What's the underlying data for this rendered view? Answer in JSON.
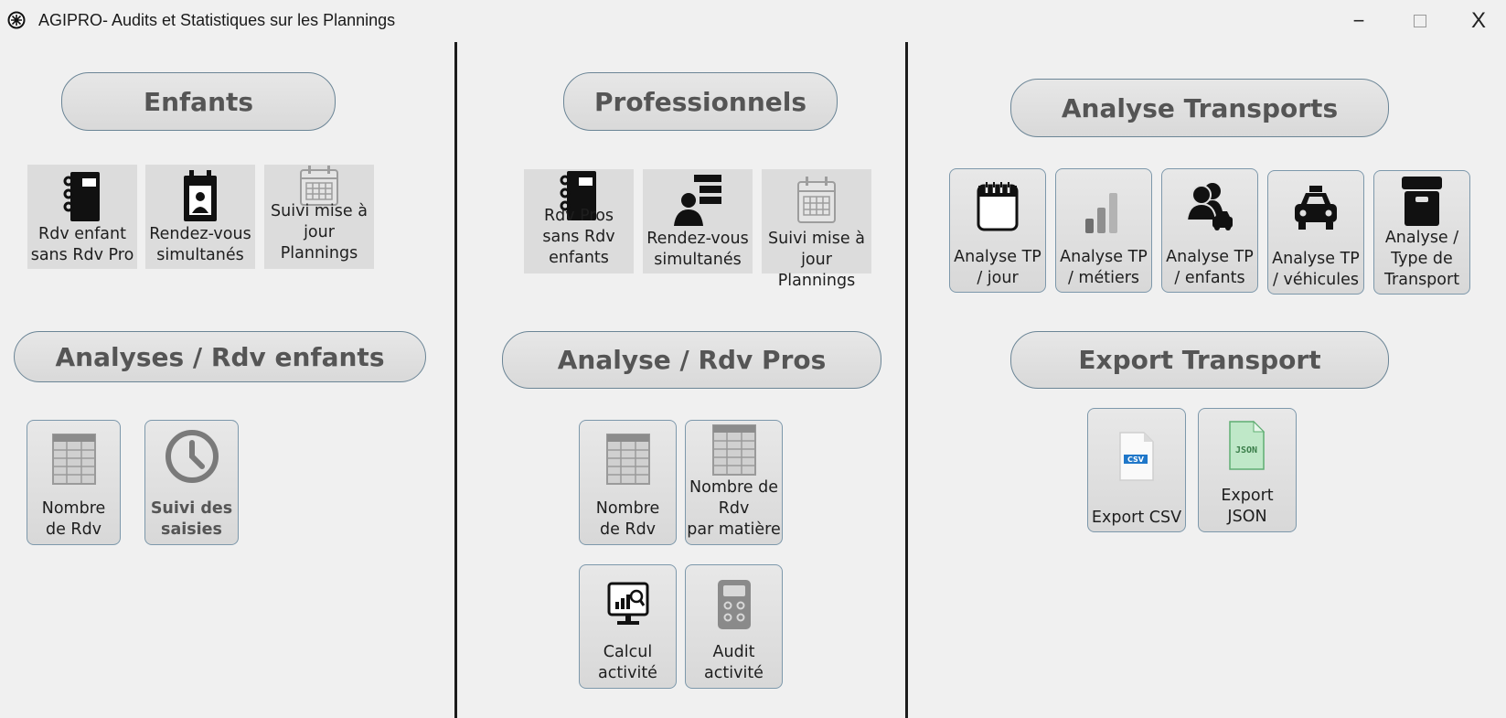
{
  "window": {
    "title": "AGIPRO- Audits et Statistiques sur les Plannings",
    "controls": {
      "minimize": "−",
      "close": "X"
    }
  },
  "enfants": {
    "header": "Enfants",
    "buttons": [
      {
        "label": "Rdv enfant\nsans Rdv Pro",
        "icon": "notebook-icon"
      },
      {
        "label": "Rendez-vous\nsimultanés",
        "icon": "id-badge-icon"
      },
      {
        "label": "Suivi mise à\njour\nPlannings",
        "icon": "calendar-icon"
      }
    ],
    "analyses_header": "Analyses / Rdv enfants",
    "analyses": [
      {
        "label": "Nombre\nde Rdv",
        "icon": "table-icon"
      },
      {
        "label": "Suivi des\nsaisies",
        "icon": "clock-icon"
      }
    ]
  },
  "professionnels": {
    "header": "Professionnels",
    "buttons": [
      {
        "label": "Rdv Pros\nsans Rdv\nenfants",
        "icon": "notebook-icon"
      },
      {
        "label": "Rendez-vous\nsimultanés",
        "icon": "person-list-icon"
      },
      {
        "label": "Suivi mise à\njour Plannings",
        "icon": "calendar-icon"
      }
    ],
    "analyses_header": "Analyse / Rdv Pros",
    "analyses": [
      {
        "label": "Nombre\nde Rdv",
        "icon": "table-icon"
      },
      {
        "label": "Nombre de\nRdv\npar matière",
        "icon": "table-icon"
      },
      {
        "label": "Calcul\nactivité",
        "icon": "monitor-chart-icon"
      },
      {
        "label": "Audit\nactivité",
        "icon": "calculator-icon"
      }
    ]
  },
  "transports": {
    "header": "Analyse Transports",
    "buttons": [
      {
        "label": "Analyse TP\n/ jour",
        "icon": "notepad-icon"
      },
      {
        "label": "Analyse TP\n/ métiers",
        "icon": "bar-chart-icon"
      },
      {
        "label": "Analyse TP\n/ enfants",
        "icon": "people-car-icon"
      },
      {
        "label": "Analyse TP\n/ véhicules",
        "icon": "taxi-icon"
      },
      {
        "label": "Analyse /\nType de\nTransport",
        "icon": "box-icon"
      }
    ],
    "export_header": "Export Transport",
    "exports": [
      {
        "label": "Export CSV",
        "icon": "csv-file-icon",
        "badge": "CSV"
      },
      {
        "label": "Export\nJSON",
        "icon": "json-file-icon",
        "badge": "JSON"
      }
    ]
  },
  "colors": {
    "background": "#f0f0f0",
    "tile_border": "#7d98ab",
    "header_text": "#555555",
    "divider": "#1c1c1c"
  }
}
